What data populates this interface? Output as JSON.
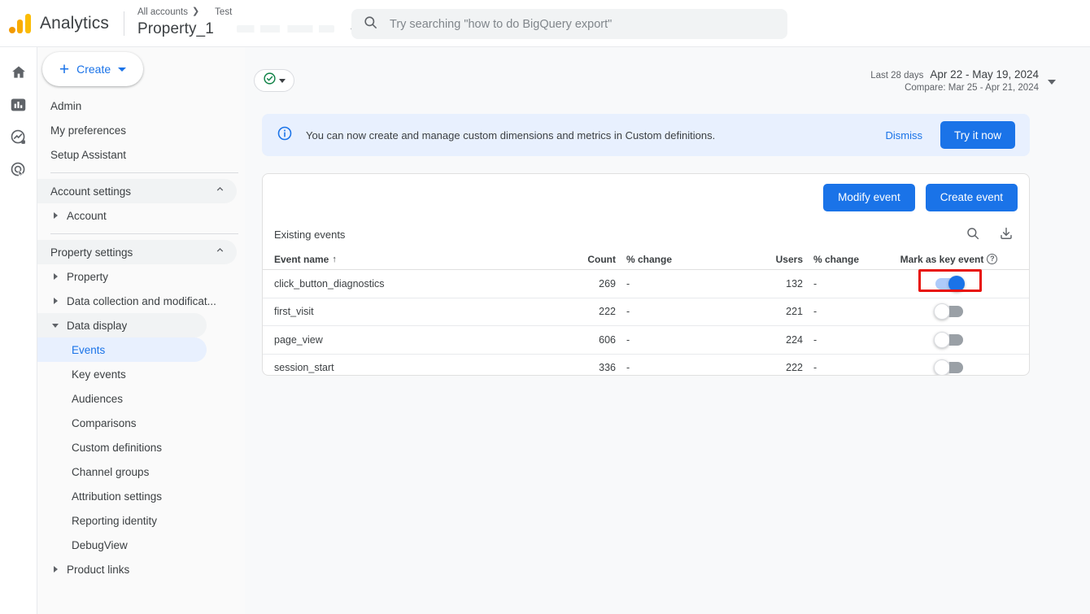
{
  "header": {
    "brand": "Analytics",
    "logo_icon": "analytics-logo-icon",
    "breadcrumb_all_accounts": "All accounts",
    "breadcrumb_arrow": "❯",
    "account_name": "Test",
    "property_name": "Property_1",
    "selector_caret_icon": "chevron-down-icon",
    "search": {
      "icon": "search-icon",
      "value": "",
      "placeholder": "Try searching \"how to do BigQuery export\""
    }
  },
  "rail": {
    "items": [
      {
        "icon": "home-icon",
        "name": "home",
        "selected": false
      },
      {
        "icon": "bar-chart-reports-icon",
        "name": "reports",
        "selected": true
      },
      {
        "icon": "explore-icon",
        "name": "explore",
        "selected": false
      },
      {
        "icon": "advertising-target-icon",
        "name": "advertising",
        "selected": false
      }
    ]
  },
  "sidebar": {
    "create_button": {
      "label": "Create",
      "plus_icon": "plus-icon",
      "caret_icon": "chevron-down-icon"
    },
    "items": [
      {
        "label": "Admin",
        "kind": "plain"
      },
      {
        "label": "My preferences",
        "kind": "plain"
      },
      {
        "label": "Setup Assistant",
        "kind": "plain"
      },
      {
        "label": "Account settings",
        "kind": "group",
        "chevron": "chevron-up-icon"
      },
      {
        "label": "Account",
        "kind": "child",
        "tri": "triangle-right-icon"
      },
      {
        "label": "Property settings",
        "kind": "group",
        "chevron": "chevron-up-icon"
      },
      {
        "label": "Property",
        "kind": "child",
        "tri": "triangle-right-icon"
      },
      {
        "label": "Data collection and modificat...",
        "kind": "child",
        "tri": "triangle-right-icon"
      },
      {
        "label": "Data display",
        "kind": "child-open",
        "tri": "triangle-down-icon"
      },
      {
        "label": "Events",
        "kind": "leaf",
        "selected": true
      },
      {
        "label": "Key events",
        "kind": "leaf"
      },
      {
        "label": "Audiences",
        "kind": "leaf"
      },
      {
        "label": "Comparisons",
        "kind": "leaf"
      },
      {
        "label": "Custom definitions",
        "kind": "leaf"
      },
      {
        "label": "Channel groups",
        "kind": "leaf"
      },
      {
        "label": "Attribution settings",
        "kind": "leaf"
      },
      {
        "label": "Reporting identity",
        "kind": "leaf"
      },
      {
        "label": "DebugView",
        "kind": "leaf"
      },
      {
        "label": "Product links",
        "kind": "child",
        "tri": "triangle-right-icon"
      }
    ]
  },
  "main": {
    "status_pill": {
      "icon": "green-check-circle-icon",
      "caret_icon": "chevron-down-icon",
      "color": "#0b8043"
    },
    "date_range": {
      "preset": "Last 28 days",
      "range": "Apr 22 - May 19, 2024",
      "compare": "Compare: Mar 25 - Apr 21, 2024",
      "caret_icon": "chevron-down-icon"
    },
    "banner": {
      "icon": "info-circle-icon",
      "text": "You can now create and manage custom dimensions and metrics in Custom definitions.",
      "dismiss_label": "Dismiss",
      "action_label": "Try it now",
      "accent": "#1a73e8",
      "background": "#e8f0fe"
    },
    "card": {
      "modify_button": "Modify event",
      "create_button": "Create event",
      "table_title": "Existing events",
      "search_icon": "search-icon",
      "download_icon": "download-icon",
      "columns": {
        "event_name": "Event name",
        "sort_icon": "arrow-up-icon",
        "count": "Count",
        "count_change": "% change",
        "users": "Users",
        "users_change": "% change",
        "mark_key": "Mark as key event",
        "help_icon": "help-circle-icon"
      },
      "rows": [
        {
          "event_name": "click_button_diagnostics",
          "count": "269",
          "count_change": "-",
          "users": "132",
          "users_change": "-",
          "key_event": true,
          "highlighted": true
        },
        {
          "event_name": "first_visit",
          "count": "222",
          "count_change": "-",
          "users": "221",
          "users_change": "-",
          "key_event": false,
          "highlighted": false
        },
        {
          "event_name": "page_view",
          "count": "606",
          "count_change": "-",
          "users": "224",
          "users_change": "-",
          "key_event": false,
          "highlighted": false
        },
        {
          "event_name": "session_start",
          "count": "336",
          "count_change": "-",
          "users": "222",
          "users_change": "-",
          "key_event": false,
          "highlighted": false
        }
      ],
      "highlight_color": "#e8120c"
    }
  }
}
